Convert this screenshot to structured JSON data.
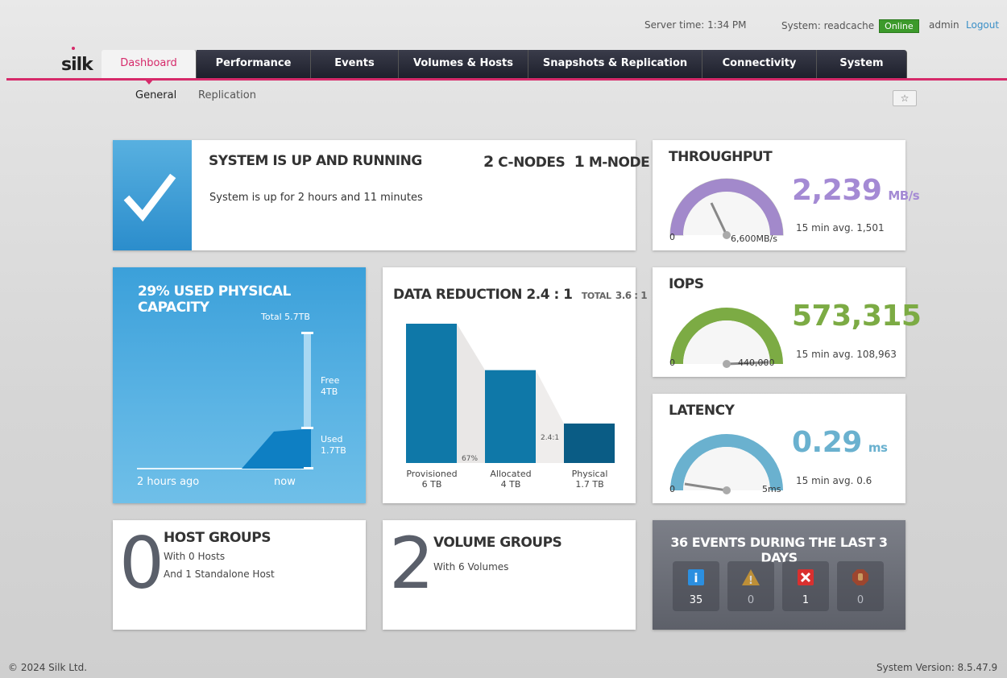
{
  "topbar": {
    "server_time": "Server time: 1:34 PM",
    "system": "System: readcache",
    "status": "Online",
    "user": "admin",
    "logout": "Logout"
  },
  "logo": "silk",
  "tabs": [
    "Dashboard",
    "Performance",
    "Events",
    "Volumes & Hosts",
    "Snapshots & Replication",
    "Connectivity",
    "System"
  ],
  "subnav": [
    "General",
    "Replication"
  ],
  "status_card": {
    "title": "SYSTEM IS UP AND RUNNING",
    "cnodes_count": "2",
    "cnodes_label": "C-NODES",
    "mnodes_count": "1",
    "mnodes_label": "M-NODE",
    "uptime": "System is up for 2 hours and 11 minutes"
  },
  "throughput": {
    "title": "THROUGHPUT",
    "value": "2,239",
    "unit": "MB/s",
    "avg": "15 min avg. 1,501",
    "scale_min": "0",
    "scale_max": "6,600MB/s",
    "fill_fraction": 0.34,
    "color": "#9b7fc9"
  },
  "iops": {
    "title": "IOPS",
    "value": "573,315",
    "avg": "15 min avg. 108,963",
    "scale_min": "0",
    "scale_max": "440,000",
    "fill_fraction": 1.0,
    "color": "#7cab44"
  },
  "latency": {
    "title": "LATENCY",
    "value": "0.29",
    "unit": "ms",
    "avg": "15 min avg. 0.6",
    "scale_min": "0",
    "scale_max": "5ms",
    "fill_fraction": 0.06,
    "color": "#6ab1cf"
  },
  "capacity": {
    "title": "29% USED PHYSICAL CAPACITY",
    "total": "Total 5.7TB",
    "free_label": "Free",
    "free_value": "4TB",
    "used_label": "Used",
    "used_value": "1.7TB",
    "x_start": "2 hours ago",
    "x_end": "now",
    "used_fraction": 0.29
  },
  "data_reduction": {
    "title": "DATA REDUCTION 2.4 : 1",
    "total_label": "TOTAL",
    "total_value": "3.6 : 1",
    "pct_label": "67%",
    "ratio_label": "2.4:1"
  },
  "chart_data": {
    "type": "bar",
    "categories": [
      "Provisioned",
      "Allocated",
      "Physical"
    ],
    "values": [
      6,
      4,
      1.7
    ],
    "value_labels": [
      "6 TB",
      "4 TB",
      "1.7 TB"
    ],
    "title": "DATA REDUCTION 2.4 : 1",
    "colors": [
      "#0f78a8",
      "#0f78a8",
      "#0a5c85"
    ]
  },
  "host_groups": {
    "count": "0",
    "title": "HOST GROUPS",
    "line1": "With 0 Hosts",
    "line2": "And 1 Standalone Host"
  },
  "volume_groups": {
    "count": "2",
    "title": "VOLUME GROUPS",
    "line1": "With 6 Volumes"
  },
  "events": {
    "title": "36 EVENTS DURING THE LAST 3 DAYS",
    "info": "35",
    "warning": "0",
    "error": "1",
    "critical": "0"
  },
  "footer": {
    "copyright": "© 2024 Silk Ltd.",
    "version": "System Version: 8.5.47.9"
  }
}
